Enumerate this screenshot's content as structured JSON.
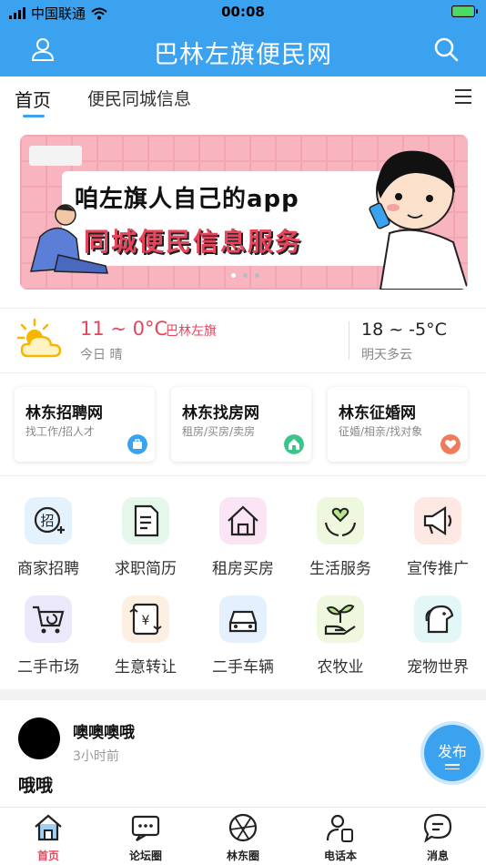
{
  "status_bar": {
    "carrier": "中国联通",
    "time": "00:08"
  },
  "header": {
    "title": "巴林左旗便民网",
    "user_icon": "user-icon",
    "search_icon": "search-icon"
  },
  "tabs": [
    {
      "label": "首页",
      "active": true
    },
    {
      "label": "便民同城信息",
      "active": false
    }
  ],
  "banner": {
    "line1": "咱左旗人自己的app",
    "line2": "同城便民信息服务",
    "slides": 3,
    "active_slide": 1
  },
  "weather": {
    "today_temp": "11 ~ 0°C",
    "city": "巴林左旗",
    "today_desc": "今日 晴",
    "tomorrow_temp": "18 ~ -5°C",
    "tomorrow_desc": "明天多云"
  },
  "site_cards": [
    {
      "title": "林东招聘网",
      "subtitle": "找工作/招人才",
      "badge_color": "#3ba2ef",
      "icon": "briefcase-icon"
    },
    {
      "title": "林东找房网",
      "subtitle": "租房/买房/卖房",
      "badge_color": "#3cc48a",
      "icon": "house-icon"
    },
    {
      "title": "林东征婚网",
      "subtitle": "征婚/相亲/找对象",
      "badge_color": "#f07a5a",
      "icon": "heart-icon"
    }
  ],
  "grid_menu": [
    {
      "label": "商家招聘",
      "bg": "#e4f2fd",
      "icon": "recruit-icon"
    },
    {
      "label": "求职简历",
      "bg": "#e4f7ea",
      "icon": "resume-icon"
    },
    {
      "label": "租房买房",
      "bg": "#fbe4f4",
      "icon": "house-icon"
    },
    {
      "label": "生活服务",
      "bg": "#eef8df",
      "icon": "heart-hands-icon"
    },
    {
      "label": "宣传推广",
      "bg": "#fde8e4",
      "icon": "megaphone-icon"
    },
    {
      "label": "二手市场",
      "bg": "#ece8fb",
      "icon": "cart-icon"
    },
    {
      "label": "生意转让",
      "bg": "#fdf0e2",
      "icon": "yuan-transfer-icon"
    },
    {
      "label": "二手车辆",
      "bg": "#e4f0fd",
      "icon": "car-icon"
    },
    {
      "label": "农牧业",
      "bg": "#eef8df",
      "icon": "sprout-icon"
    },
    {
      "label": "宠物世界",
      "bg": "#e2f7f6",
      "icon": "dog-icon"
    }
  ],
  "post": {
    "user": "噢噢噢哦",
    "time": "3小时前",
    "content": "哦哦"
  },
  "fab": {
    "label": "发布"
  },
  "bottom_nav": [
    {
      "label": "首页",
      "icon": "home-icon",
      "active": true
    },
    {
      "label": "论坛圈",
      "icon": "chat-icon",
      "active": false
    },
    {
      "label": "林东圈",
      "icon": "aperture-icon",
      "active": false
    },
    {
      "label": "电话本",
      "icon": "contact-phone-icon",
      "active": false
    },
    {
      "label": "消息",
      "icon": "message-icon",
      "active": false
    }
  ],
  "colors": {
    "primary": "#3ba2ef",
    "accent_red": "#e8455c"
  }
}
